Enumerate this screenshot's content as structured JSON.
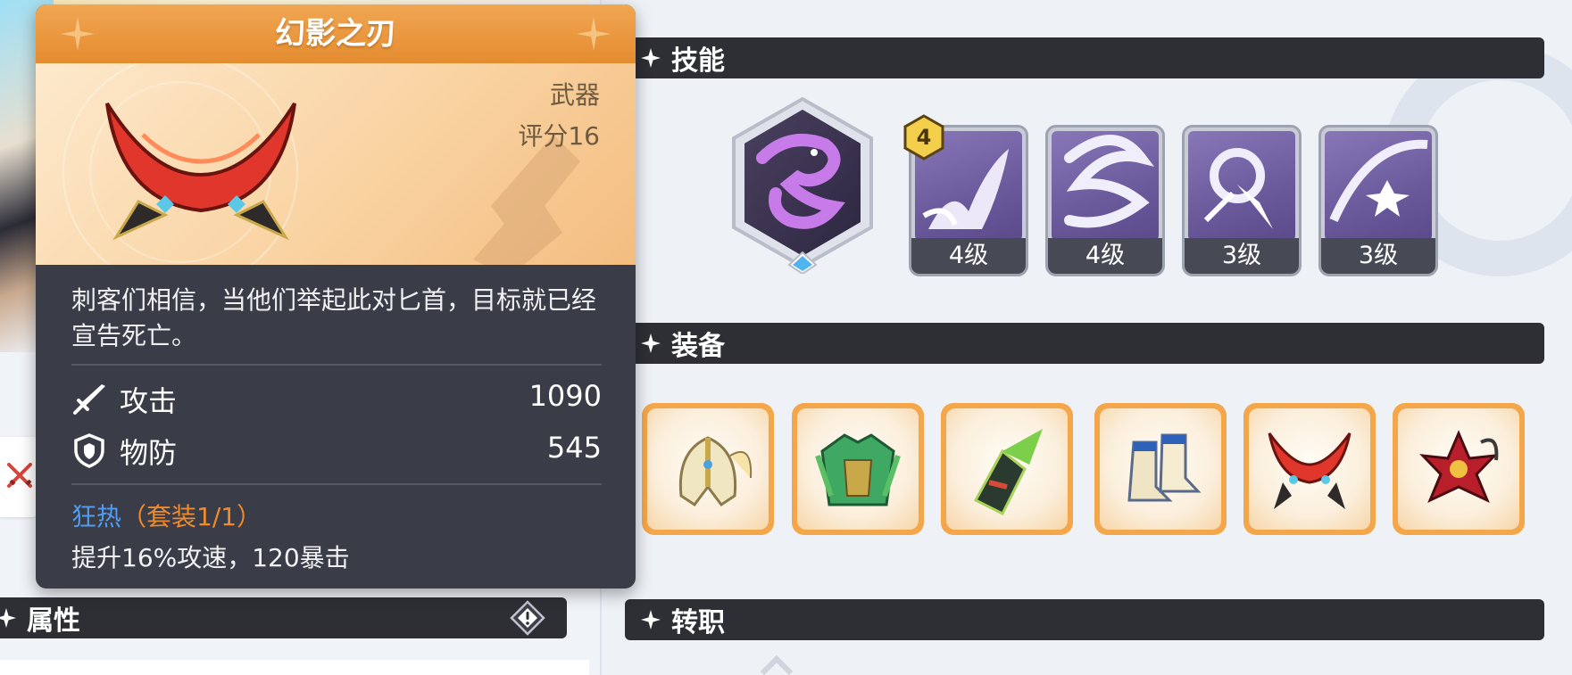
{
  "tooltip": {
    "title": "幻影之刃",
    "item_type": "武器",
    "score": "评分16",
    "description": "刺客们相信，当他们举起此对匕首，目标就已经宣告死亡。",
    "stats": [
      {
        "icon": "sword-icon",
        "label": "攻击",
        "value": "1090"
      },
      {
        "icon": "shield-icon",
        "label": "物防",
        "value": "545"
      }
    ],
    "set_name": "狂热",
    "set_count": "（套装1/1）",
    "set_effect": "提升16%攻速，120暴击"
  },
  "sections": {
    "skills": "技能",
    "equipment": "装备",
    "class_change": "转职",
    "attributes": "属性"
  },
  "skills": {
    "main_icon": "snake-skill-icon",
    "badge": "4",
    "items": [
      {
        "icon": "slash-skill-icon",
        "level": "4级"
      },
      {
        "icon": "wind-slash-skill-icon",
        "level": "4级"
      },
      {
        "icon": "dagger-strike-skill-icon",
        "level": "3级"
      },
      {
        "icon": "star-burst-skill-icon",
        "level": "3级"
      }
    ]
  },
  "equipment": [
    {
      "icon": "helmet-icon"
    },
    {
      "icon": "armor-icon"
    },
    {
      "icon": "gauntlet-icon"
    },
    {
      "icon": "boots-icon"
    },
    {
      "icon": "twin-daggers-icon"
    },
    {
      "icon": "red-flower-accessory-icon"
    }
  ],
  "colors": {
    "title_orange": "#e48c30",
    "panel_dark": "#3a3d47",
    "set_name_blue": "#4f9cf0",
    "set_count_orange": "#f08a2a",
    "skill_purple": "#6a5a9c",
    "equip_frame": "#f4a64a"
  }
}
